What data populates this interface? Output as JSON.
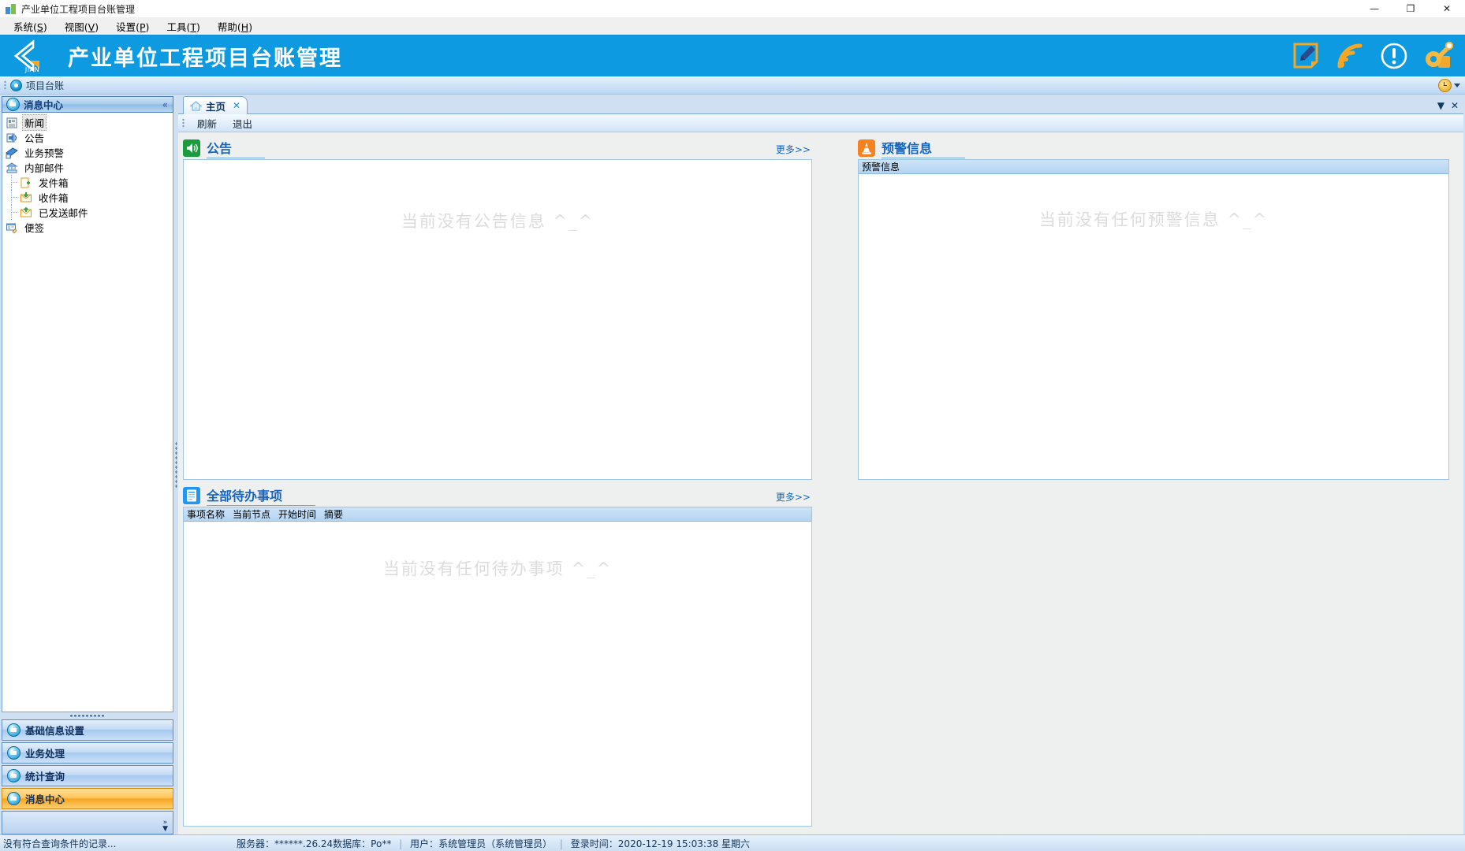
{
  "window": {
    "title": "产业单位工程项目台账管理",
    "icon": "app-icon",
    "controls": {
      "minimize": "—",
      "maximize": "❐",
      "close": "✕"
    }
  },
  "menubar": {
    "items": [
      {
        "name": "system",
        "label": "系统",
        "accel": "S"
      },
      {
        "name": "view",
        "label": "视图",
        "accel": "V"
      },
      {
        "name": "settings",
        "label": "设置",
        "accel": "P"
      },
      {
        "name": "tools",
        "label": "工具",
        "accel": "T"
      },
      {
        "name": "help",
        "label": "帮助",
        "accel": "H"
      }
    ]
  },
  "banner": {
    "logo_text": "JIAN",
    "title": "产业单位工程项目台账管理",
    "accent": "#0d9ae0",
    "icons": [
      {
        "name": "edit-note-icon",
        "label": "编辑"
      },
      {
        "name": "rss-signal-icon",
        "label": "信号"
      },
      {
        "name": "exclamation-circle-icon",
        "label": "提示"
      },
      {
        "name": "key-icon",
        "label": "密钥"
      }
    ]
  },
  "breadcrumb": {
    "label": "项目台账",
    "clock_icon": "clock-icon"
  },
  "sidebar": {
    "panel_title": "消息中心",
    "collapse_label": "«",
    "tree": [
      {
        "name": "news",
        "label": "新闻",
        "icon": "news-icon",
        "selected": true,
        "child": false
      },
      {
        "name": "announcement",
        "label": "公告",
        "icon": "announcement-icon",
        "selected": false,
        "child": false
      },
      {
        "name": "business-alert",
        "label": "业务预警",
        "icon": "alert-icon",
        "selected": false,
        "child": false
      },
      {
        "name": "internal-mail",
        "label": "内部邮件",
        "icon": "mail-folder-icon",
        "selected": false,
        "child": false
      },
      {
        "name": "outbox",
        "label": "发件箱",
        "icon": "outbox-icon",
        "selected": false,
        "child": true
      },
      {
        "name": "inbox",
        "label": "收件箱",
        "icon": "inbox-icon",
        "selected": false,
        "child": true
      },
      {
        "name": "sent-mail",
        "label": "已发送邮件",
        "icon": "sent-icon",
        "selected": false,
        "child": true
      },
      {
        "name": "sticky-note",
        "label": "便签",
        "icon": "note-icon",
        "selected": false,
        "child": false
      }
    ],
    "nav_buttons": [
      {
        "name": "basic-info-settings",
        "label": "基础信息设置",
        "active": false
      },
      {
        "name": "business-processing",
        "label": "业务处理",
        "active": false
      },
      {
        "name": "statistics-query",
        "label": "统计查询",
        "active": false
      },
      {
        "name": "message-center",
        "label": "消息中心",
        "active": true
      }
    ],
    "nav_more": "»"
  },
  "main": {
    "tabs": [
      {
        "name": "home",
        "label": "主页",
        "icon": "home-icon",
        "closable": true,
        "active": true
      }
    ],
    "tabstrip_controls": {
      "list": "▼",
      "close": "✕"
    },
    "toolbar": [
      {
        "name": "refresh-button",
        "label": "刷新"
      },
      {
        "name": "exit-button",
        "label": "退出"
      }
    ],
    "cards": [
      {
        "name": "announcement-card",
        "title": "公告",
        "icon": "speaker-icon",
        "icon_color": "#1a9c3e",
        "more_label": "更多>>",
        "columns": [],
        "empty": "当前没有公告信息 ^_^"
      },
      {
        "name": "warning-info-card",
        "title": "预警信息",
        "icon": "traffic-cone-icon",
        "icon_color": "#f5811f",
        "more_label": "",
        "columns": [
          "预警信息"
        ],
        "empty": "当前没有任何预警信息 ^_^"
      },
      {
        "name": "todo-card",
        "title": "全部待办事项",
        "icon": "clipboard-icon",
        "icon_color": "#2196f3",
        "more_label": "更多>>",
        "columns": [
          "事项名称",
          "当前节点",
          "开始时间",
          "摘要"
        ],
        "empty": "当前没有任何待办事项 ^_^"
      }
    ]
  },
  "statusbar": {
    "left": "没有符合查询条件的记录...",
    "server_label": "服务器：",
    "server_value": "******.26.24数据库：Po**",
    "user_label": "用户：",
    "user_value": "系统管理员（系统管理员）",
    "login_label": "登录时间：",
    "login_value": "2020-12-19 15:03:38 星期六"
  }
}
